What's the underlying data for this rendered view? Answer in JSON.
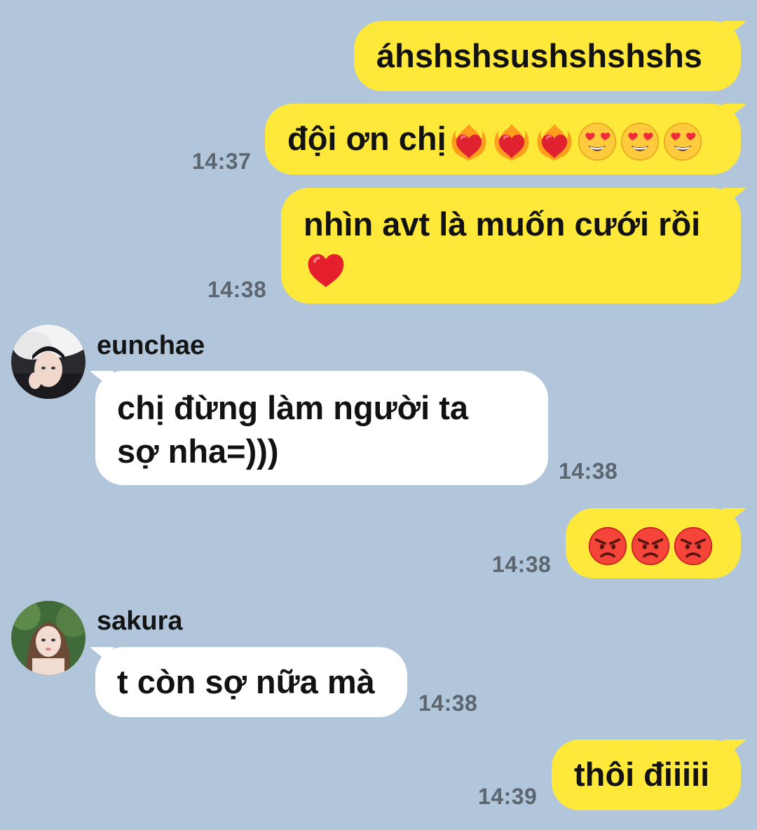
{
  "messages": [
    {
      "id": "m1",
      "direction": "outgoing",
      "text": "áhshshsushshshshs",
      "time": ""
    },
    {
      "id": "m2",
      "direction": "outgoing",
      "text": "đội ơn chị",
      "emojis": [
        "heart-on-fire",
        "heart-on-fire",
        "heart-on-fire",
        "heart-eyes",
        "heart-eyes",
        "heart-eyes"
      ],
      "time": "14:37"
    },
    {
      "id": "m3",
      "direction": "outgoing",
      "lines": [
        "nhìn avt là muốn cưới rồi"
      ],
      "emojis": [
        "red-heart"
      ],
      "time": "14:38"
    },
    {
      "id": "m4",
      "direction": "incoming",
      "sender": "eunchae",
      "lines": [
        "chị đừng làm người ta",
        "sợ nha=)))"
      ],
      "time": "14:38"
    },
    {
      "id": "m5",
      "direction": "outgoing",
      "emojis": [
        "angry-face",
        "angry-face",
        "angry-face"
      ],
      "time": "14:38"
    },
    {
      "id": "m6",
      "direction": "incoming",
      "sender": "sakura",
      "text": "t còn sợ nữa mà",
      "time": "14:38"
    },
    {
      "id": "m7",
      "direction": "outgoing",
      "text": "thôi điiiii",
      "time": "14:39"
    }
  ],
  "colors": {
    "background": "#b1c5db",
    "outgoing_bubble": "#fee93a",
    "incoming_bubble": "#ffffff",
    "timestamp": "#5d6670"
  }
}
